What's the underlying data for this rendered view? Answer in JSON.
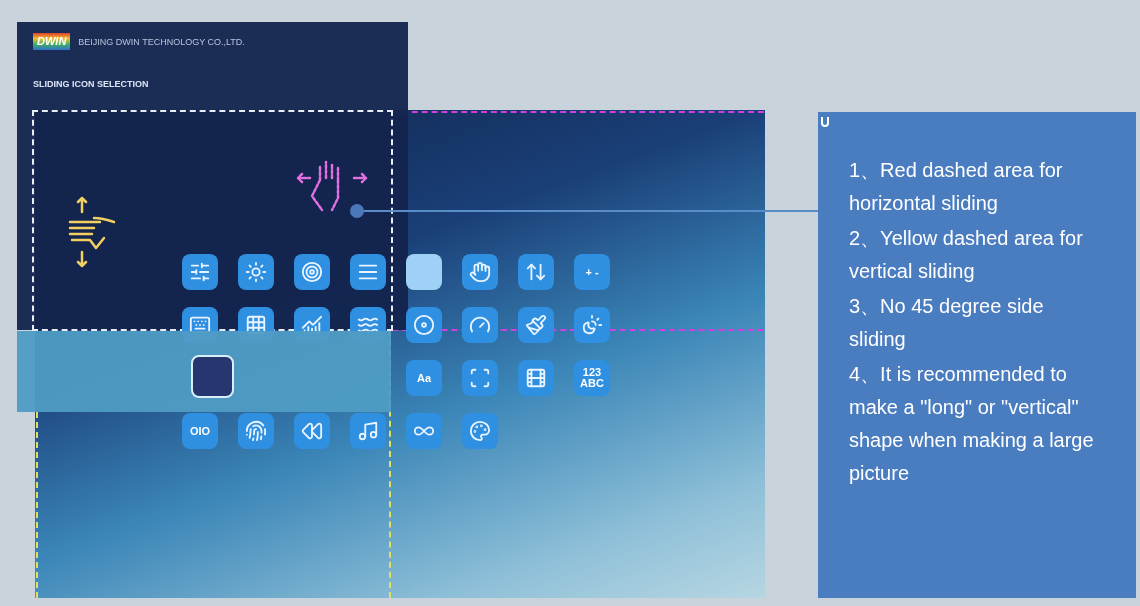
{
  "device_panel": {
    "logo": "DWIN",
    "company": "BEIJING DWIN TECHNOLOGY CO.,LTD.",
    "title": "SLIDING ICON SELECTION"
  },
  "icon_rows": [
    {
      "left_icons": [
        {
          "kind": "slider"
        },
        {
          "kind": "sun"
        },
        {
          "kind": "target"
        },
        {
          "kind": "lines"
        }
      ],
      "right_icons": [
        {
          "kind": "blank"
        },
        {
          "kind": "hand"
        },
        {
          "kind": "swipe"
        },
        {
          "kind": "text",
          "text": "+ -"
        }
      ]
    },
    {
      "left_icons": [
        {
          "kind": "keyboard"
        },
        {
          "kind": "grid"
        },
        {
          "kind": "chart"
        },
        {
          "kind": "waves"
        }
      ],
      "right_icons": [
        {
          "kind": "disc"
        },
        {
          "kind": "gauge"
        },
        {
          "kind": "brush"
        },
        {
          "kind": "brightness"
        }
      ]
    },
    {
      "right_icons": [
        {
          "kind": "text",
          "text": "Aa"
        },
        {
          "kind": "frame"
        },
        {
          "kind": "film"
        },
        {
          "kind": "text",
          "text": "123\nABC"
        }
      ]
    },
    {
      "left_icons": [
        {
          "kind": "text",
          "text": "OIO"
        },
        {
          "kind": "fingerprint"
        },
        {
          "kind": "rewind"
        },
        {
          "kind": "music"
        }
      ],
      "right_icons": [
        {
          "kind": "infinity"
        },
        {
          "kind": "palette"
        }
      ]
    }
  ],
  "notes": [
    "1、Red dashed area for horizontal sliding",
    "2、Yellow dashed area for vertical sliding",
    "3、No 45 degree side sliding",
    "4、It is recommended to make a \"long\" or \"vertical\" shape when making a large picture"
  ]
}
